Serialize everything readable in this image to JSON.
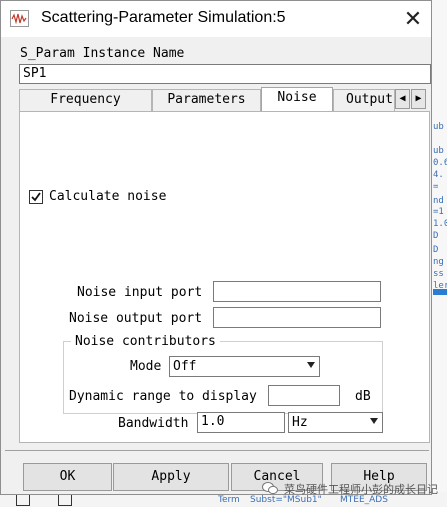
{
  "window": {
    "title": "Scattering-Parameter Simulation:5",
    "close_glyph": "✕"
  },
  "instance": {
    "label": "S_Param Instance Name",
    "value": "SP1"
  },
  "tabs": [
    {
      "label": "Frequency"
    },
    {
      "label": "Parameters"
    },
    {
      "label": "Noise",
      "active": true
    },
    {
      "label": "Output"
    }
  ],
  "tab_scroll": {
    "left_icon": "chevron-left-icon",
    "right_icon": "chevron-right-icon"
  },
  "noise": {
    "calculate_label": "Calculate noise",
    "calculate_checked": true,
    "input_port_label": "Noise input port",
    "input_port_value": "",
    "output_port_label": "Noise output port",
    "output_port_value": "",
    "contributors_legend": "Noise contributors",
    "mode_label": "Mode",
    "mode_value": "Off",
    "dynamic_range_label": "Dynamic range to display",
    "dynamic_range_value": "",
    "dynamic_range_unit": "dB",
    "bandwidth_label": "Bandwidth",
    "bandwidth_value": "1.0",
    "bandwidth_unit": "Hz"
  },
  "buttons": {
    "ok": "OK",
    "apply": "Apply",
    "cancel": "Cancel",
    "help": "Help"
  },
  "background": {
    "right_fragments": [
      "ub",
      "ub",
      "0.6",
      "4.",
      "=",
      "nd",
      "=1",
      "1.0",
      "D",
      "D",
      "ng",
      "ss",
      "ler"
    ],
    "bottom_fragments": [
      "Term",
      "Subst=\"MSub1\"",
      "MTEE_ADS"
    ]
  },
  "watermark": {
    "text": "菜鸟硬件工程师小彭的成长日记"
  },
  "colors": {
    "accent_blue": "#2b7cd3",
    "window_bg": "#f0f0f0"
  }
}
